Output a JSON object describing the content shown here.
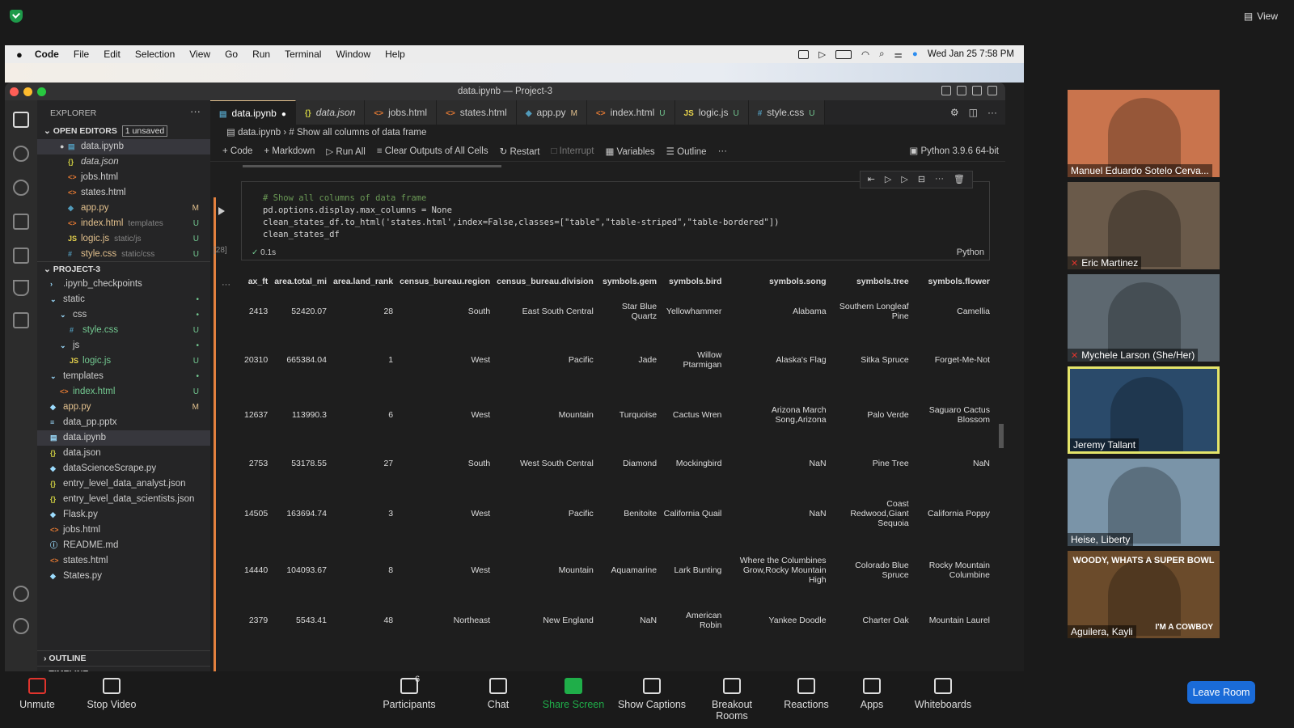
{
  "zoom": {
    "view_label": "View",
    "participants_count": "6",
    "toolbar": [
      "Unmute",
      "Stop Video",
      "Participants",
      "Chat",
      "Share Screen",
      "Show Captions",
      "Breakout Rooms",
      "Reactions",
      "Apps",
      "Whiteboards"
    ],
    "leave_label": "Leave Room",
    "gallery": [
      {
        "name": "Manuel Eduardo Sotelo Cerva...",
        "muted": false
      },
      {
        "name": "Eric Martinez",
        "muted": true
      },
      {
        "name": "Mychele Larson (She/Her)",
        "muted": true
      },
      {
        "name": "Jeremy Tallant",
        "muted": false
      },
      {
        "name": "Heise, Liberty",
        "muted": false
      },
      {
        "name": "Aguilera, Kayli",
        "muted": false
      }
    ],
    "meme_top": "WOODY, WHATS A SUPER BOWL",
    "meme_bottom": "I'M A COWBOY"
  },
  "mac": {
    "menu": [
      "Code",
      "File",
      "Edit",
      "Selection",
      "View",
      "Go",
      "Run",
      "Terminal",
      "Window",
      "Help"
    ],
    "clock": "Wed Jan 25  7:58 PM"
  },
  "vscode": {
    "title": "data.ipynb — Project-3",
    "explorer_label": "EXPLORER",
    "open_editors_label": "OPEN EDITORS",
    "unsaved_badge": "1 unsaved",
    "open_editors": [
      {
        "name": "data.ipynb",
        "sub": "",
        "status": "",
        "icon": "▤"
      },
      {
        "name": "data.json",
        "sub": "",
        "status": "",
        "icon": "{}"
      },
      {
        "name": "jobs.html",
        "sub": "",
        "status": "",
        "icon": "<>"
      },
      {
        "name": "states.html",
        "sub": "",
        "status": "",
        "icon": "<>"
      },
      {
        "name": "app.py",
        "sub": "",
        "status": "M",
        "icon": "◆"
      },
      {
        "name": "index.html",
        "sub": "templates",
        "status": "U",
        "icon": "<>"
      },
      {
        "name": "logic.js",
        "sub": "static/js",
        "status": "U",
        "icon": "JS"
      },
      {
        "name": "style.css",
        "sub": "static/css",
        "status": "U",
        "icon": "#"
      }
    ],
    "project_label": "PROJECT-3",
    "project_tree": [
      {
        "name": ".ipynb_checkpoints",
        "indent": 1,
        "icon": "›",
        "status": ""
      },
      {
        "name": "static",
        "indent": 1,
        "icon": "⌄",
        "status": "•"
      },
      {
        "name": "css",
        "indent": 2,
        "icon": "⌄",
        "status": "•"
      },
      {
        "name": "style.css",
        "indent": 3,
        "icon": "#",
        "status": "U"
      },
      {
        "name": "js",
        "indent": 2,
        "icon": "⌄",
        "status": "•"
      },
      {
        "name": "logic.js",
        "indent": 3,
        "icon": "JS",
        "status": "U"
      },
      {
        "name": "templates",
        "indent": 1,
        "icon": "⌄",
        "status": "•"
      },
      {
        "name": "index.html",
        "indent": 2,
        "icon": "<>",
        "status": "U"
      },
      {
        "name": "app.py",
        "indent": 1,
        "icon": "◆",
        "status": "M"
      },
      {
        "name": "data_pp.pptx",
        "indent": 1,
        "icon": "≡",
        "status": ""
      },
      {
        "name": "data.ipynb",
        "indent": 1,
        "icon": "▤",
        "status": ""
      },
      {
        "name": "data.json",
        "indent": 1,
        "icon": "{}",
        "status": ""
      },
      {
        "name": "dataScienceScrape.py",
        "indent": 1,
        "icon": "◆",
        "status": ""
      },
      {
        "name": "entry_level_data_analyst.json",
        "indent": 1,
        "icon": "{}",
        "status": ""
      },
      {
        "name": "entry_level_data_scientists.json",
        "indent": 1,
        "icon": "{}",
        "status": ""
      },
      {
        "name": "Flask.py",
        "indent": 1,
        "icon": "◆",
        "status": ""
      },
      {
        "name": "jobs.html",
        "indent": 1,
        "icon": "<>",
        "status": ""
      },
      {
        "name": "README.md",
        "indent": 1,
        "icon": "ⓘ",
        "status": ""
      },
      {
        "name": "states.html",
        "indent": 1,
        "icon": "<>",
        "status": ""
      },
      {
        "name": "States.py",
        "indent": 1,
        "icon": "◆",
        "status": ""
      }
    ],
    "outline_label": "OUTLINE",
    "timeline_label": "TIMELINE",
    "tabs": [
      {
        "name": "data.ipynb",
        "flag": "●",
        "icon": "▤"
      },
      {
        "name": "data.json",
        "flag": "",
        "icon": "{}"
      },
      {
        "name": "jobs.html",
        "flag": "",
        "icon": "<>"
      },
      {
        "name": "states.html",
        "flag": "",
        "icon": "<>"
      },
      {
        "name": "app.py",
        "flag": "M",
        "icon": "◆"
      },
      {
        "name": "index.html",
        "flag": "U",
        "icon": "<>"
      },
      {
        "name": "logic.js",
        "flag": "U",
        "icon": "JS"
      },
      {
        "name": "style.css",
        "flag": "U",
        "icon": "#"
      }
    ],
    "breadcrumb": [
      "data.ipynb",
      "# Show all columns of data frame"
    ],
    "nb_toolbar": [
      "+ Code",
      "+ Markdown",
      "▷ Run All",
      "≡ Clear Outputs of All Cells",
      "↻ Restart",
      "□ Interrupt",
      "▦ Variables",
      "☰ Outline",
      "···"
    ],
    "kernel": "Python 3.9.6 64-bit",
    "cell": {
      "exec_count": "[28]",
      "lines": [
        "# Show all columns of data frame",
        "pd.options.display.max_columns = None",
        "clean_states_df.to_html('states.html',index=False,classes=[\"table\",\"table-striped\",\"table-bordered\"])",
        "clean_states_df"
      ],
      "time": "0.1s",
      "lang": "Python"
    },
    "table": {
      "columns": [
        "ax_ft",
        "area.total_mi",
        "area.land_rank",
        "census_bureau.region",
        "census_bureau.division",
        "symbols.gem",
        "symbols.bird",
        "symbols.song",
        "symbols.tree",
        "symbols.flower"
      ],
      "rows": [
        [
          "2413",
          "52420.07",
          "28",
          "South",
          "East South Central",
          "Star Blue Quartz",
          "Yellowhammer",
          "Alabama",
          "Southern Longleaf Pine",
          "Camellia"
        ],
        [
          "20310",
          "665384.04",
          "1",
          "West",
          "Pacific",
          "Jade",
          "Willow Ptarmigan",
          "Alaska's Flag",
          "Sitka Spruce",
          "Forget-Me-Not"
        ],
        [
          "12637",
          "113990.3",
          "6",
          "West",
          "Mountain",
          "Turquoise",
          "Cactus Wren",
          "Arizona March Song,Arizona",
          "Palo Verde",
          "Saguaro Cactus Blossom"
        ],
        [
          "2753",
          "53178.55",
          "27",
          "South",
          "West South Central",
          "Diamond",
          "Mockingbird",
          "NaN",
          "Pine Tree",
          "NaN"
        ],
        [
          "14505",
          "163694.74",
          "3",
          "West",
          "Pacific",
          "Benitoite",
          "California Quail",
          "NaN",
          "Coast Redwood,Giant Sequoia",
          "California Poppy"
        ],
        [
          "14440",
          "104093.67",
          "8",
          "West",
          "Mountain",
          "Aquamarine",
          "Lark Bunting",
          "Where the Columbines Grow,Rocky Mountain High",
          "Colorado Blue Spruce",
          "Rocky Mountain Columbine"
        ],
        [
          "2379",
          "5543.41",
          "48",
          "Northeast",
          "New England",
          "NaN",
          "American Robin",
          "Yankee Doodle",
          "Charter Oak",
          "Mountain Laurel"
        ]
      ]
    }
  }
}
